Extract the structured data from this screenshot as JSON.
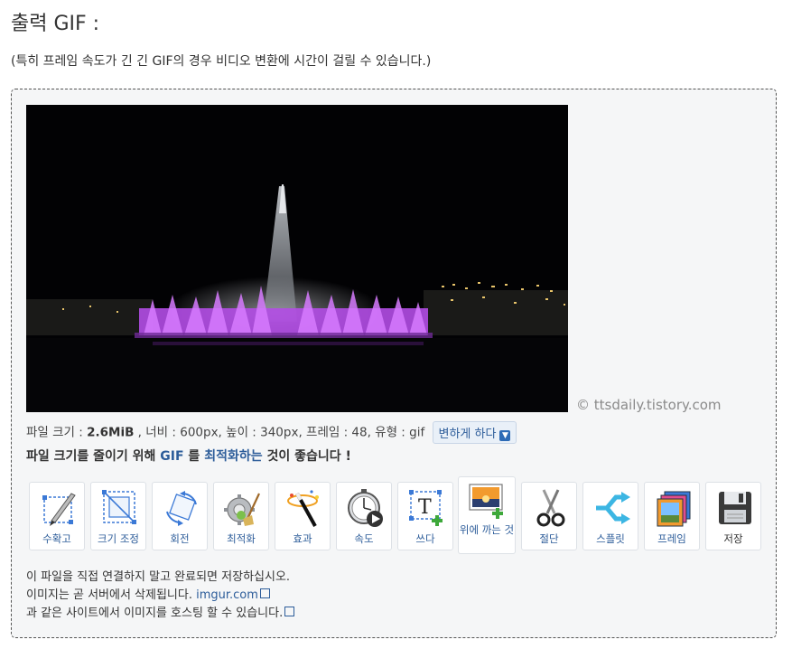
{
  "heading": "출력 GIF :",
  "note": "(특히 프레임 속도가 긴 긴 GIF의 경우 비디오 변환에 시간이 걸릴 수 있습니다.)",
  "watermark": "© ttsdaily.tistory.com",
  "meta": {
    "size_label": "파일 크기 : ",
    "size_value": "2.6MiB",
    "width_label": " , 너비 : 600px, 높이 : 340px, 프레임 : 48, 유형 : gif",
    "convert_label": "변하게 하다"
  },
  "advice": {
    "part1": "파일 크기를 줄이기 위해 ",
    "gif": "GIF",
    "part2": " 를 ",
    "optimize": "최적화하는",
    "part3": " 것이 좋습니다 !"
  },
  "tools": [
    {
      "label": "수확고",
      "icon": "crop-icon"
    },
    {
      "label": "크기 조정",
      "icon": "resize-icon"
    },
    {
      "label": "회전",
      "icon": "rotate-icon"
    },
    {
      "label": "최적화",
      "icon": "optimize-icon"
    },
    {
      "label": "효과",
      "icon": "effects-icon"
    },
    {
      "label": "속도",
      "icon": "speed-icon"
    },
    {
      "label": "쓰다",
      "icon": "text-icon"
    },
    {
      "label": "위에 까는 것",
      "icon": "overlay-icon"
    },
    {
      "label": "절단",
      "icon": "cut-icon"
    },
    {
      "label": "스플릿",
      "icon": "split-icon"
    },
    {
      "label": "프레임",
      "icon": "frames-icon"
    },
    {
      "label": "저장",
      "icon": "save-icon"
    }
  ],
  "footer": {
    "line1": "이 파일을 직접 연결하지 말고 완료되면 저장하십시오.",
    "line2": "이미지는 곧 서버에서 삭제됩니다. ",
    "link": "imgur.com",
    "line3": "과 같은 사이트에서 이미지를 호스팅 할 수 있습니다."
  }
}
